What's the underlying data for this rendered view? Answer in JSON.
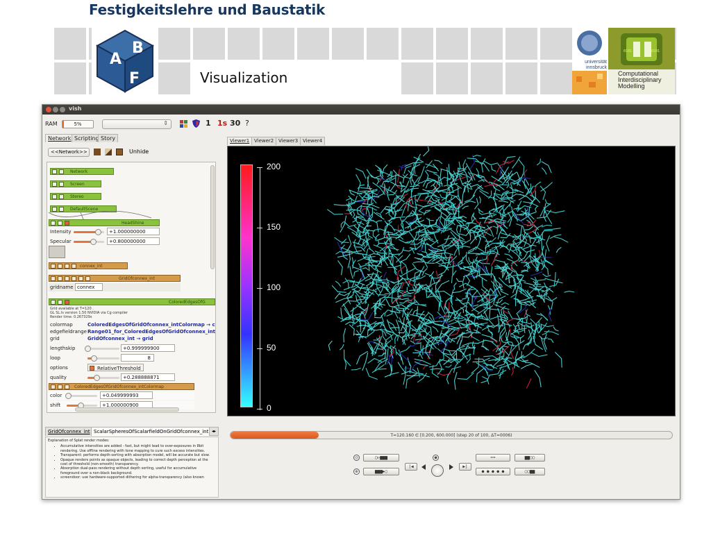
{
  "slide": {
    "title": "Festigkeitslehre und Baustatik",
    "section_label": "Visualization",
    "logo_abf_letters": [
      "A",
      "B",
      "F"
    ],
    "logo_uni_text": "universität innsbruck",
    "logo_cim_lines": [
      "Computational",
      "Interdisciplinary",
      "Modelling"
    ]
  },
  "window": {
    "title": "vish",
    "ram_label": "RAM",
    "ram_percent_text": "5%",
    "ram_fraction": 0.05,
    "toolbar_numbers": [
      "1",
      "1s",
      "30",
      "?"
    ]
  },
  "left_panel": {
    "tabs": [
      "Network",
      "Scripting",
      "Story"
    ],
    "active_tab": "Network",
    "network_combo": "<<Network>>",
    "unhide_label": "Unhide",
    "nodes": {
      "network": "Network",
      "screen": "Screen",
      "stereo": "Stereo",
      "default_scene": "DefaultScene",
      "headshine": "HeadShine",
      "connex_int": "connex_int",
      "grid_of_connex": "GridOfconnex_int",
      "colored_edges": "ColoredEdgesOfG",
      "colormap_node": "ColoredEdgesOfGridOfconnex_intColormap"
    },
    "headshine_props": [
      {
        "label": "Intensity",
        "value": "+1.000000000",
        "fraction": 0.8
      },
      {
        "label": "Specular",
        "value": "+0.800000000",
        "fraction": 0.64
      }
    ],
    "gridname": {
      "label": "gridname",
      "value": "connex"
    },
    "info_lines": [
      "Grid available at T=120 .",
      "GL SL.ls version 1.50 NVIDIA via Cg compiler",
      "Render time: 0.267329s"
    ],
    "edges_props": [
      {
        "label": "colormap",
        "value": "ColoredEdgesOfGridOfconnex_intColormap → colo"
      },
      {
        "label": "edgefieldrange",
        "value": "Range01_for_ColoredEdgesOfGridOfconnex_int_ec"
      },
      {
        "label": "grid",
        "value": "GridOfconnex_int → grid"
      }
    ],
    "edges_sliders": [
      {
        "label": "lengthskip",
        "value": "+0.999999900",
        "fraction": 0.0
      },
      {
        "label": "loop",
        "value": "8",
        "fraction": 0.2
      },
      {
        "label": "options",
        "value": "RelativeThreshold"
      },
      {
        "label": "quality",
        "value": "+0.288888871",
        "fraction": 0.29
      }
    ],
    "colormap_props": [
      {
        "label": "color",
        "value": "+0.049999993",
        "fraction": 0.05
      },
      {
        "label": "shift",
        "value": "+1.000000900",
        "fraction": 0.45
      }
    ]
  },
  "viewer": {
    "tabs": [
      "Viewer1",
      "Viewer2",
      "Viewer3",
      "Viewer4"
    ],
    "active_tab": "Viewer1",
    "legend_ticks": [
      "200",
      "150",
      "100",
      "50",
      "0"
    ]
  },
  "bottom_left": {
    "tabs": [
      "GridOfconnex_int",
      "ScalarSpheresOfScalarfieldOnGridOfconnex_int"
    ],
    "active_tab": "ScalarSpheresOfScalarfieldOnGridOfconnex_int",
    "explanation_title": "Explanation of Splat render modes:",
    "explanation_items": [
      "Accumulative intensities are added - fast, but might lead to over-exposures in 8bit rendering. Use offline rendering with tone mapping to cure such excess intensities.",
      "Transparent: performs depth-sorting with absorption model, will be accurate but slow.",
      "Opaque renders points as opaque objects, leading to correct depth perception at the cost of threshold (non-smooth) transparency.",
      "Absorption dual-pass rendering without depth sorting, useful for accumulative foreground over a non-black background.",
      "screendoor: use hardware-supported dithering for alpha-transparency (also known"
    ]
  },
  "timeline": {
    "progress_text": "T=120.160 ∈ [0.200, 600.000]  (step 20 of 100, ΔT=0006)",
    "progress_fraction": 0.2
  },
  "colors": {
    "title_blue": "#17375e",
    "tile_gray": "#d9d9d9",
    "progress_orange": "#e36a2a",
    "edge_cyan": "#3ec9c9",
    "node_green": "#8ac23d"
  }
}
